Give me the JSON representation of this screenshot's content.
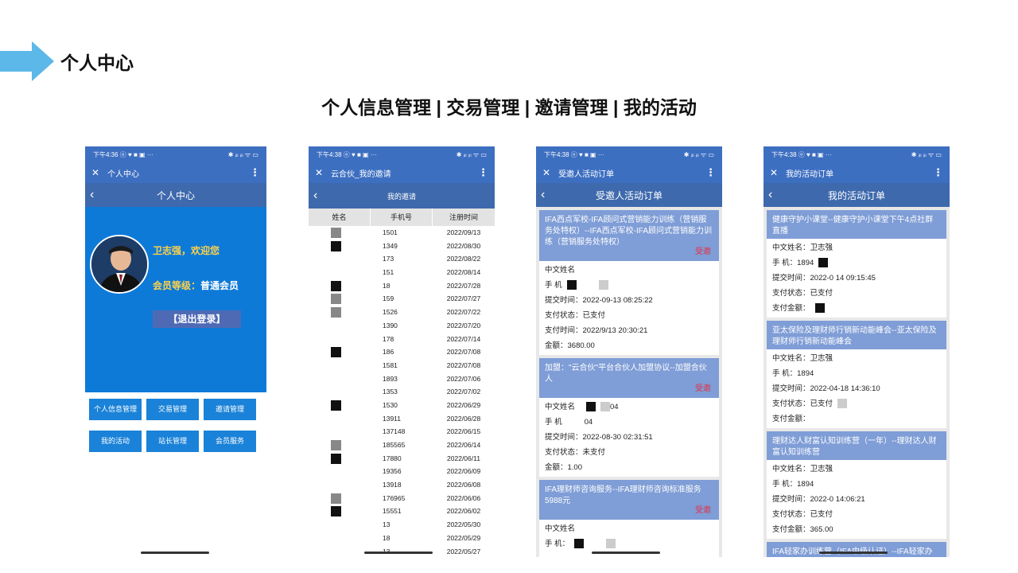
{
  "slide": {
    "title": "个人中心",
    "subtitle": "个人信息管理 | 交易管理 | 邀请管理 | 我的活动",
    "arrow_color": "#5bb8e8"
  },
  "status": {
    "time1": "下午4:36 ⓞ ♥ ■ ▣ ···",
    "time2": "下午4:38 ⓞ ♥ ■ ▣ ···",
    "icons": "✱ ᵢₗₗ ᵢₗₗ ᯤ ▭"
  },
  "phone1": {
    "app_title": "个人中心",
    "nav_title": "个人中心",
    "greeting": "卫志强，欢迎您",
    "level_label": "会员等级：",
    "level_value": "普通会员",
    "logout": "【退出登录】",
    "buttons": [
      "个人信息管理",
      "交易管理",
      "邀请管理",
      "我的活动",
      "站长管理",
      "会员服务"
    ]
  },
  "phone2": {
    "app_title": "云合伙_我的邀请",
    "nav_title": "我的邀请",
    "headers": [
      "姓名",
      "手机号",
      "注册时间"
    ],
    "rows": [
      {
        "phone": "1501",
        "date": "2022/09/13"
      },
      {
        "phone": "1349",
        "date": "2022/08/30"
      },
      {
        "phone": "173",
        "date": "2022/08/22"
      },
      {
        "phone": "151",
        "date": "2022/08/14"
      },
      {
        "phone": "18",
        "date": "2022/07/28"
      },
      {
        "phone": "159",
        "date": "2022/07/27"
      },
      {
        "phone": "1526",
        "date": "2022/07/22"
      },
      {
        "phone": "1390",
        "date": "2022/07/20"
      },
      {
        "phone": "178",
        "date": "2022/07/14"
      },
      {
        "phone": "186",
        "date": "2022/07/08"
      },
      {
        "phone": "1581",
        "date": "2022/07/08"
      },
      {
        "phone": "1893",
        "date": "2022/07/06"
      },
      {
        "phone": "1353",
        "date": "2022/07/02"
      },
      {
        "phone": "1530",
        "date": "2022/06/29"
      },
      {
        "phone": "13911",
        "date": "2022/06/28"
      },
      {
        "phone": "137148",
        "date": "2022/06/15"
      },
      {
        "phone": "185565",
        "date": "2022/06/14"
      },
      {
        "phone": "17880",
        "date": "2022/06/11"
      },
      {
        "phone": "19356",
        "date": "2022/06/09"
      },
      {
        "phone": "13918",
        "date": "2022/06/08"
      },
      {
        "phone": "176965",
        "date": "2022/06/06"
      },
      {
        "phone": "15551",
        "date": "2022/06/02"
      },
      {
        "phone": "13",
        "date": "2022/05/30"
      },
      {
        "phone": "18",
        "date": "2022/05/29"
      },
      {
        "phone": "13",
        "date": "2022/05/27"
      }
    ]
  },
  "phone3": {
    "app_title": "受邀人活动订单",
    "nav_title": "受邀人活动订单",
    "invite_tag": "受邀",
    "cards": [
      {
        "title": "IFA西点军校-IFA顾问式营销能力训练（营销服务处特权）--IFA西点军校-IFA顾问式营销能力训练（营销服务处特权）",
        "name": "中文姓名",
        "phone": "手      机",
        "submit": "提交时间：2022-09-13 08:25:22",
        "status": "支付状态：已支付",
        "paytime": "支付时间：2022/9/13 20:30:21",
        "amount": "金额：3680.00"
      },
      {
        "title": "加盟：\"云合伙\"平台合伙人加盟协议--加盟合伙人",
        "name": "中文姓名",
        "phone": "手      机",
        "phone_tail": "04",
        "submit": "提交时间：2022-08-30 02:31:51",
        "status": "支付状态：未支付",
        "amount": "金额：1.00"
      },
      {
        "title": "IFA理财师咨询服务--IFA理财师咨询标准服务5988元",
        "name": "中文姓名",
        "phone": "手      机："
      }
    ]
  },
  "phone4": {
    "app_title": "我的活动订单",
    "nav_title": "我的活动订单",
    "cards": [
      {
        "title": "健康守护小课堂--健康守护小课堂下午4点社群直播",
        "name": "中文姓名：卫志强",
        "phone": "手      机：1894",
        "submit": "提交时间：2022-0  14 09:15:45",
        "status": "支付状态：已支付",
        "amount": "支付金额："
      },
      {
        "title": "亚太保险及理财师行销新动能峰会--亚太保险及理财师行销新动能峰会",
        "name": "中文姓名：卫志强",
        "phone": "手      机：1894",
        "submit": "提交时间：2022-04-18 14:36:10",
        "status": "支付状态：已支付",
        "amount": "支付金额："
      },
      {
        "title": "理财达人财富认知训练营（一年）--理财达人财富认知训练营",
        "name": "中文姓名：卫志强",
        "phone": "手      机：1894",
        "submit": "提交时间：2022-0  14:06:21",
        "status": "支付状态：已支付",
        "amount": "支付金额：365.00"
      },
      {
        "title": "IFA轻家办训练营（IFA中级认证）--IFA轻家办"
      }
    ]
  }
}
